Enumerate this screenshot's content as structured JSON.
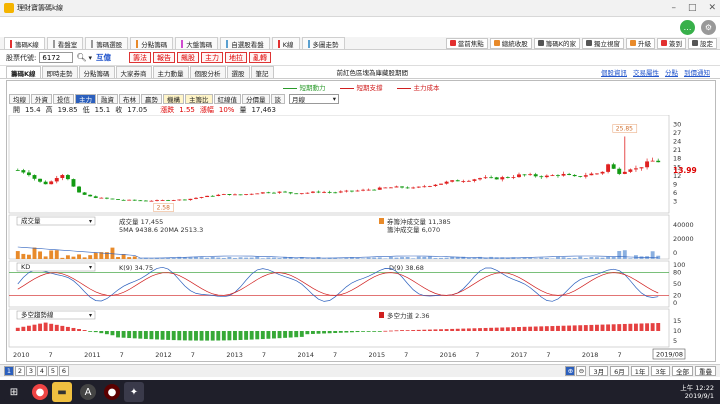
{
  "window": {
    "title": "理財寶籌碼k線"
  },
  "menu_tabs": [
    {
      "label": "籌碼K線",
      "color": "#e23030",
      "active": true
    },
    {
      "label": "看盤室",
      "color": "#999999"
    },
    {
      "label": "籌碼選股",
      "color": "#999999"
    },
    {
      "label": "分點籌碼",
      "color": "#e88a2a"
    },
    {
      "label": "大盤籌碼",
      "color": "#d04bd0"
    },
    {
      "label": "自選股看盤",
      "color": "#5aa0d0"
    },
    {
      "label": "K線",
      "color": "#e23030"
    },
    {
      "label": "多圖走勢",
      "color": "#5aa0d0"
    }
  ],
  "right_buttons": [
    {
      "label": "當前焦點",
      "color": "#e23030"
    },
    {
      "label": "總統收股",
      "color": "#e88a2a"
    },
    {
      "label": "籌碼K的家",
      "color": "#555555"
    },
    {
      "label": "獨立視窗",
      "color": "#555555"
    },
    {
      "label": "升級",
      "color": "#e88a2a"
    },
    {
      "label": "簽到",
      "color": "#e23030"
    },
    {
      "label": "設定",
      "color": "#555555"
    }
  ],
  "toolbar": {
    "code_label": "股票代號:",
    "code_value": "6172",
    "name": "互億",
    "buttons": [
      "籌法",
      "報告",
      "飆股",
      "主力",
      "地拉",
      "亂轉"
    ]
  },
  "sub_tabs": [
    "籌碼K線",
    "即時走勢",
    "分點籌碼",
    "大家券商",
    "主力動量",
    "個股分析",
    "選股",
    "筆記"
  ],
  "center_title": "前紅色區塊為庫藏股期間",
  "right_links": [
    "個股資訊",
    "交易屬性",
    "分點",
    "到價通知"
  ],
  "legend": [
    {
      "label": "短期動力",
      "color": "#2a9a2a"
    },
    {
      "label": "短期支撐",
      "color": "#d02020"
    },
    {
      "label": "主力成本",
      "color": "#d02020"
    }
  ],
  "chart_tools": [
    "均線",
    "外資",
    "投信",
    "主力",
    "融資",
    "布林",
    "贏勢",
    "機構",
    "主籌比",
    "紅線值",
    "分價量",
    "談"
  ],
  "period": "月線",
  "ohlc": {
    "open_label": "開",
    "open": "15.4",
    "high_label": "高",
    "high": "19.85",
    "low_label": "低",
    "low": "15.1",
    "close_label": "收",
    "close": "17.05",
    "chg_label": "漲跌",
    "chg": "1.55",
    "pct_label": "漲幅",
    "pct": "10%",
    "vol_label": "量",
    "vol": "17,463"
  },
  "price_axis": [
    "30",
    "27",
    "24",
    "21",
    "18",
    "15",
    "12",
    "9",
    "6",
    "3"
  ],
  "price_last": "13.99",
  "peak_label": "25.85",
  "low_label": "2.58",
  "volume_panel": {
    "select": "成交量",
    "vol_label": "成交量",
    "vol": "17,455",
    "ma5_label": "5MA",
    "ma5": "9438.6",
    "ma20_label": "20MA",
    "ma20": "2513.3",
    "buy_label": "券籌沖成交量",
    "buy": "11,385",
    "sell_label": "籌沖成交量",
    "sell": "6,070",
    "axis": [
      "40000",
      "20000",
      "0"
    ]
  },
  "kd_panel": {
    "select": "KD",
    "k_label": "K(9)",
    "k": "34.75",
    "d_label": "D(9)",
    "d": "38.68",
    "axis": [
      "100",
      "80",
      "50",
      "20",
      "0"
    ]
  },
  "trend_panel": {
    "select": "多空趨勢線",
    "label": "多空力道",
    "value": "2.36",
    "axis": [
      "15",
      "10",
      "5"
    ]
  },
  "x_axis": [
    "2010",
    "7",
    "2011",
    "7",
    "2012",
    "7",
    "2013",
    "7",
    "2014",
    "7",
    "2015",
    "7",
    "2016",
    "7",
    "2017",
    "7",
    "2018",
    "7",
    "2019"
  ],
  "date_badge": "2019/08",
  "status": {
    "pages": [
      "1",
      "2",
      "3",
      "4",
      "5",
      "6"
    ],
    "ranges": [
      "3月",
      "6月",
      "1年",
      "3年",
      "全部",
      "重疊"
    ]
  },
  "clock": {
    "time": "上午 12:22",
    "date": "2019/9/1"
  },
  "chart_data": {
    "type": "candlestick",
    "period": "monthly",
    "x_range": [
      "2010-01",
      "2019-08"
    ],
    "ylim": [
      1,
      32
    ],
    "highlighted_high": 25.85,
    "highlighted_low": 2.58,
    "last_price": 13.99,
    "latest_bar": {
      "open": 15.4,
      "high": 19.85,
      "low": 15.1,
      "close": 17.05,
      "volume": 17463
    },
    "close_profile": [
      [
        0,
        14
      ],
      [
        3,
        13
      ],
      [
        6,
        10
      ],
      [
        9,
        9
      ],
      [
        12,
        12
      ],
      [
        14,
        13
      ],
      [
        16,
        9
      ],
      [
        18,
        6
      ],
      [
        22,
        4.5
      ],
      [
        26,
        4
      ],
      [
        30,
        3.5
      ],
      [
        34,
        3.4
      ],
      [
        38,
        3.2
      ],
      [
        42,
        3.3
      ],
      [
        46,
        3.5
      ],
      [
        50,
        3.6
      ],
      [
        54,
        4.4
      ],
      [
        58,
        5
      ],
      [
        62,
        5.5
      ],
      [
        66,
        5.2
      ],
      [
        70,
        5.8
      ],
      [
        74,
        6.2
      ],
      [
        78,
        6.3
      ],
      [
        82,
        5.8
      ],
      [
        86,
        6
      ],
      [
        90,
        6.4
      ],
      [
        94,
        6.1
      ],
      [
        98,
        6.5
      ],
      [
        102,
        6.8
      ],
      [
        106,
        7.3
      ],
      [
        110,
        7.8
      ],
      [
        114,
        8
      ],
      [
        118,
        7.6
      ],
      [
        122,
        8.5
      ],
      [
        126,
        9.3
      ],
      [
        130,
        10.2
      ],
      [
        134,
        10.5
      ],
      [
        138,
        11.2
      ],
      [
        142,
        11
      ],
      [
        146,
        11.5
      ],
      [
        150,
        12.3
      ],
      [
        154,
        12
      ],
      [
        158,
        11.8
      ],
      [
        162,
        12.6
      ],
      [
        166,
        11.5
      ],
      [
        170,
        12.5
      ],
      [
        174,
        13
      ],
      [
        176,
        16
      ],
      [
        178,
        14
      ],
      [
        180,
        12.8
      ],
      [
        182,
        15
      ],
      [
        184,
        14.2
      ],
      [
        186,
        15.4
      ],
      [
        188,
        16.6
      ],
      [
        190,
        17.5
      ],
      [
        191,
        17.05
      ]
    ]
  }
}
